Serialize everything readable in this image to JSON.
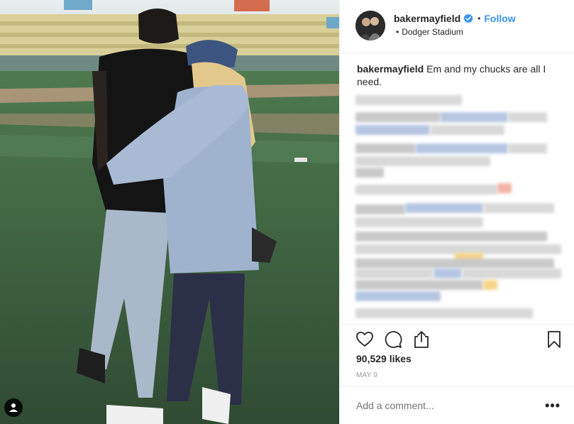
{
  "post": {
    "username": "bakermayfield",
    "follow_label": "Follow",
    "location": "Dodger Stadium",
    "caption_user": "bakermayfield",
    "caption_text": "Em and my chucks are all I need.",
    "likes": "90,529 likes",
    "date": "MAY 9",
    "comment_placeholder": "Add a comment...",
    "more_label": "•••"
  },
  "icons": {
    "verified": "verified-badge-icon",
    "like": "heart-icon",
    "comment": "comment-icon",
    "share": "share-icon",
    "save": "bookmark-icon",
    "user_tag": "user-tag-icon"
  },
  "colors": {
    "link": "#3897f0",
    "text": "#262626",
    "muted": "#999999",
    "border": "#efefef"
  }
}
